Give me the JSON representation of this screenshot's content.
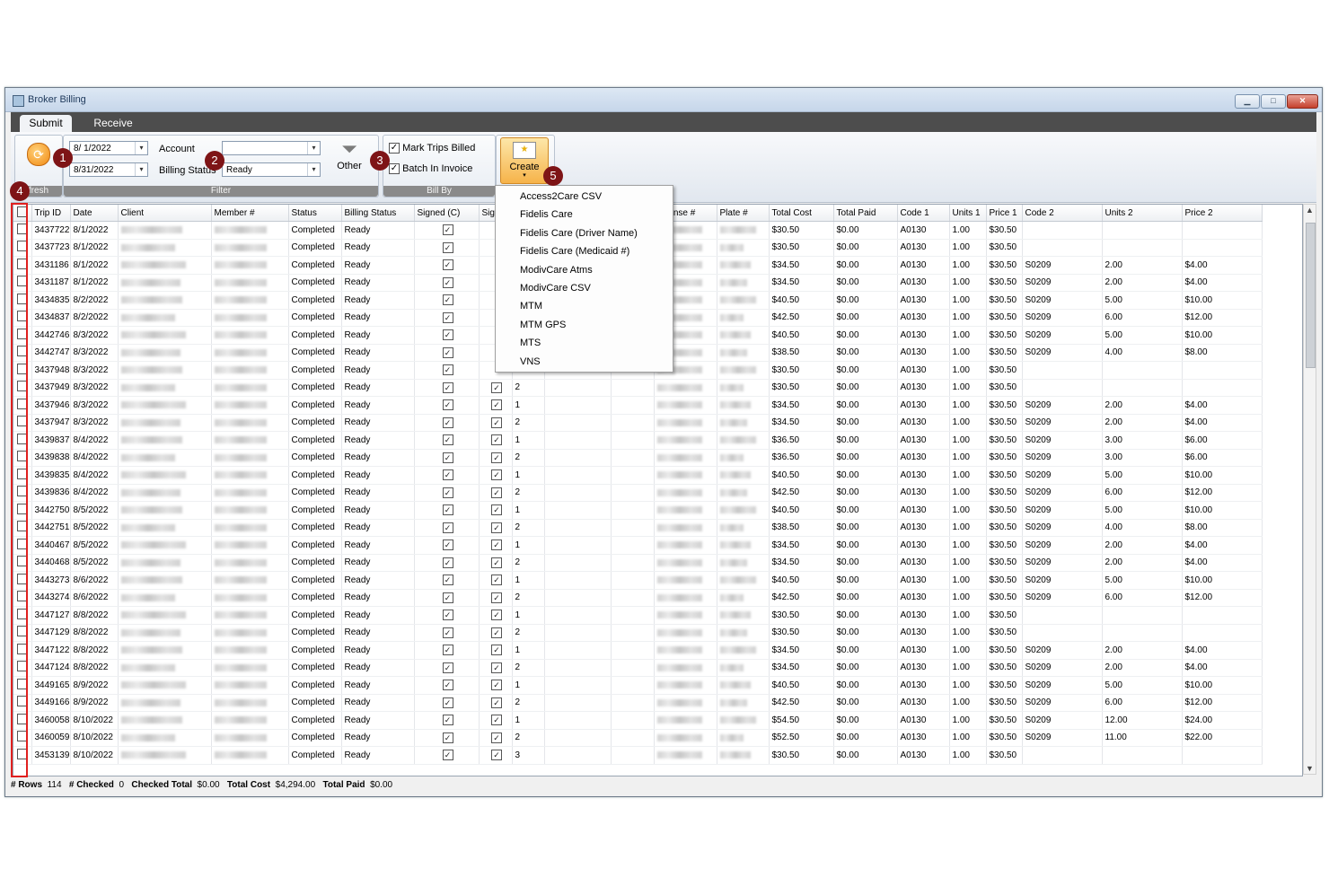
{
  "window": {
    "title": "Broker Billing",
    "min": "▁",
    "max": "□",
    "close": "✕"
  },
  "tabs": {
    "submit": "Submit",
    "receive": "Receive"
  },
  "ribbon": {
    "refresh_label": "fresh",
    "filter": {
      "date_from": "8/ 1/2022",
      "date_to": "8/31/2022",
      "account_label": "Account",
      "account_value": "",
      "billing_status_label": "Billing Status",
      "billing_status_value": "Ready",
      "other_label": "Other",
      "group_label": "Filter"
    },
    "bill_by": {
      "mark_trips_billed": "Mark Trips Billed",
      "batch_in_invoice": "Batch In Invoice",
      "group_label": "Bill By"
    },
    "create_label": "Create"
  },
  "callouts": [
    "1",
    "2",
    "3",
    "4",
    "5"
  ],
  "create_menu": [
    "Access2Care CSV",
    "Fidelis Care",
    "Fidelis Care (Driver Name)",
    "Fidelis Care (Medicaid #)",
    "ModivCare Atms",
    "ModivCare CSV",
    "MTM",
    "MTM GPS",
    "MTS",
    "VNS"
  ],
  "columns": [
    "",
    "Trip ID",
    "Date",
    "Client",
    "Member #",
    "Status",
    "Billing Status",
    "Signed (C)",
    "Sig",
    "",
    "",
    "",
    "License #",
    "Plate #",
    "Total Cost",
    "Total Paid",
    "Code 1",
    "Units 1",
    "Price 1",
    "Code 2",
    "Units 2",
    "Price 2"
  ],
  "rows": [
    [
      "3437722",
      "8/1/2022",
      "",
      "$30.50",
      "$0.00",
      "A0130",
      "1.00",
      "$30.50",
      "",
      "",
      ""
    ],
    [
      "3437723",
      "8/1/2022",
      "",
      "$30.50",
      "$0.00",
      "A0130",
      "1.00",
      "$30.50",
      "",
      "",
      ""
    ],
    [
      "3431186",
      "8/1/2022",
      "",
      "$34.50",
      "$0.00",
      "A0130",
      "1.00",
      "$30.50",
      "S0209",
      "2.00",
      "$4.00"
    ],
    [
      "3431187",
      "8/1/2022",
      "",
      "$34.50",
      "$0.00",
      "A0130",
      "1.00",
      "$30.50",
      "S0209",
      "2.00",
      "$4.00"
    ],
    [
      "3434835",
      "8/2/2022",
      "",
      "$40.50",
      "$0.00",
      "A0130",
      "1.00",
      "$30.50",
      "S0209",
      "5.00",
      "$10.00"
    ],
    [
      "3434837",
      "8/2/2022",
      "",
      "$42.50",
      "$0.00",
      "A0130",
      "1.00",
      "$30.50",
      "S0209",
      "6.00",
      "$12.00"
    ],
    [
      "3442746",
      "8/3/2022",
      "",
      "$40.50",
      "$0.00",
      "A0130",
      "1.00",
      "$30.50",
      "S0209",
      "5.00",
      "$10.00"
    ],
    [
      "3442747",
      "8/3/2022",
      "",
      "$38.50",
      "$0.00",
      "A0130",
      "1.00",
      "$30.50",
      "S0209",
      "4.00",
      "$8.00"
    ],
    [
      "3437948",
      "8/3/2022",
      "",
      "$30.50",
      "$0.00",
      "A0130",
      "1.00",
      "$30.50",
      "",
      "",
      ""
    ],
    [
      "3437949",
      "8/3/2022",
      "2",
      "$30.50",
      "$0.00",
      "A0130",
      "1.00",
      "$30.50",
      "",
      "",
      ""
    ],
    [
      "3437946",
      "8/3/2022",
      "1",
      "$34.50",
      "$0.00",
      "A0130",
      "1.00",
      "$30.50",
      "S0209",
      "2.00",
      "$4.00"
    ],
    [
      "3437947",
      "8/3/2022",
      "2",
      "$34.50",
      "$0.00",
      "A0130",
      "1.00",
      "$30.50",
      "S0209",
      "2.00",
      "$4.00"
    ],
    [
      "3439837",
      "8/4/2022",
      "1",
      "$36.50",
      "$0.00",
      "A0130",
      "1.00",
      "$30.50",
      "S0209",
      "3.00",
      "$6.00"
    ],
    [
      "3439838",
      "8/4/2022",
      "2",
      "$36.50",
      "$0.00",
      "A0130",
      "1.00",
      "$30.50",
      "S0209",
      "3.00",
      "$6.00"
    ],
    [
      "3439835",
      "8/4/2022",
      "1",
      "$40.50",
      "$0.00",
      "A0130",
      "1.00",
      "$30.50",
      "S0209",
      "5.00",
      "$10.00"
    ],
    [
      "3439836",
      "8/4/2022",
      "2",
      "$42.50",
      "$0.00",
      "A0130",
      "1.00",
      "$30.50",
      "S0209",
      "6.00",
      "$12.00"
    ],
    [
      "3442750",
      "8/5/2022",
      "1",
      "$40.50",
      "$0.00",
      "A0130",
      "1.00",
      "$30.50",
      "S0209",
      "5.00",
      "$10.00"
    ],
    [
      "3442751",
      "8/5/2022",
      "2",
      "$38.50",
      "$0.00",
      "A0130",
      "1.00",
      "$30.50",
      "S0209",
      "4.00",
      "$8.00"
    ],
    [
      "3440467",
      "8/5/2022",
      "1",
      "$34.50",
      "$0.00",
      "A0130",
      "1.00",
      "$30.50",
      "S0209",
      "2.00",
      "$4.00"
    ],
    [
      "3440468",
      "8/5/2022",
      "2",
      "$34.50",
      "$0.00",
      "A0130",
      "1.00",
      "$30.50",
      "S0209",
      "2.00",
      "$4.00"
    ],
    [
      "3443273",
      "8/6/2022",
      "1",
      "$40.50",
      "$0.00",
      "A0130",
      "1.00",
      "$30.50",
      "S0209",
      "5.00",
      "$10.00"
    ],
    [
      "3443274",
      "8/6/2022",
      "2",
      "$42.50",
      "$0.00",
      "A0130",
      "1.00",
      "$30.50",
      "S0209",
      "6.00",
      "$12.00"
    ],
    [
      "3447127",
      "8/8/2022",
      "1",
      "$30.50",
      "$0.00",
      "A0130",
      "1.00",
      "$30.50",
      "",
      "",
      ""
    ],
    [
      "3447129",
      "8/8/2022",
      "2",
      "$30.50",
      "$0.00",
      "A0130",
      "1.00",
      "$30.50",
      "",
      "",
      ""
    ],
    [
      "3447122",
      "8/8/2022",
      "1",
      "$34.50",
      "$0.00",
      "A0130",
      "1.00",
      "$30.50",
      "S0209",
      "2.00",
      "$4.00"
    ],
    [
      "3447124",
      "8/8/2022",
      "2",
      "$34.50",
      "$0.00",
      "A0130",
      "1.00",
      "$30.50",
      "S0209",
      "2.00",
      "$4.00"
    ],
    [
      "3449165",
      "8/9/2022",
      "1",
      "$40.50",
      "$0.00",
      "A0130",
      "1.00",
      "$30.50",
      "S0209",
      "5.00",
      "$10.00"
    ],
    [
      "3449166",
      "8/9/2022",
      "2",
      "$42.50",
      "$0.00",
      "A0130",
      "1.00",
      "$30.50",
      "S0209",
      "6.00",
      "$12.00"
    ],
    [
      "3460058",
      "8/10/2022",
      "1",
      "$54.50",
      "$0.00",
      "A0130",
      "1.00",
      "$30.50",
      "S0209",
      "12.00",
      "$24.00"
    ],
    [
      "3460059",
      "8/10/2022",
      "2",
      "$52.50",
      "$0.00",
      "A0130",
      "1.00",
      "$30.50",
      "S0209",
      "11.00",
      "$22.00"
    ],
    [
      "3453139",
      "8/10/2022",
      "3",
      "$30.50",
      "$0.00",
      "A0130",
      "1.00",
      "$30.50",
      "",
      "",
      ""
    ]
  ],
  "status_text": "Completed",
  "billing_status_text": "Ready",
  "statusbar": {
    "rows_label": "# Rows",
    "rows_value": "114",
    "checked_label": "# Checked",
    "checked_value": "0",
    "checked_total_label": "Checked Total",
    "checked_total_value": "$0.00",
    "total_cost_label": "Total Cost",
    "total_cost_value": "$4,294.00",
    "total_paid_label": "Total Paid",
    "total_paid_value": "$0.00"
  }
}
